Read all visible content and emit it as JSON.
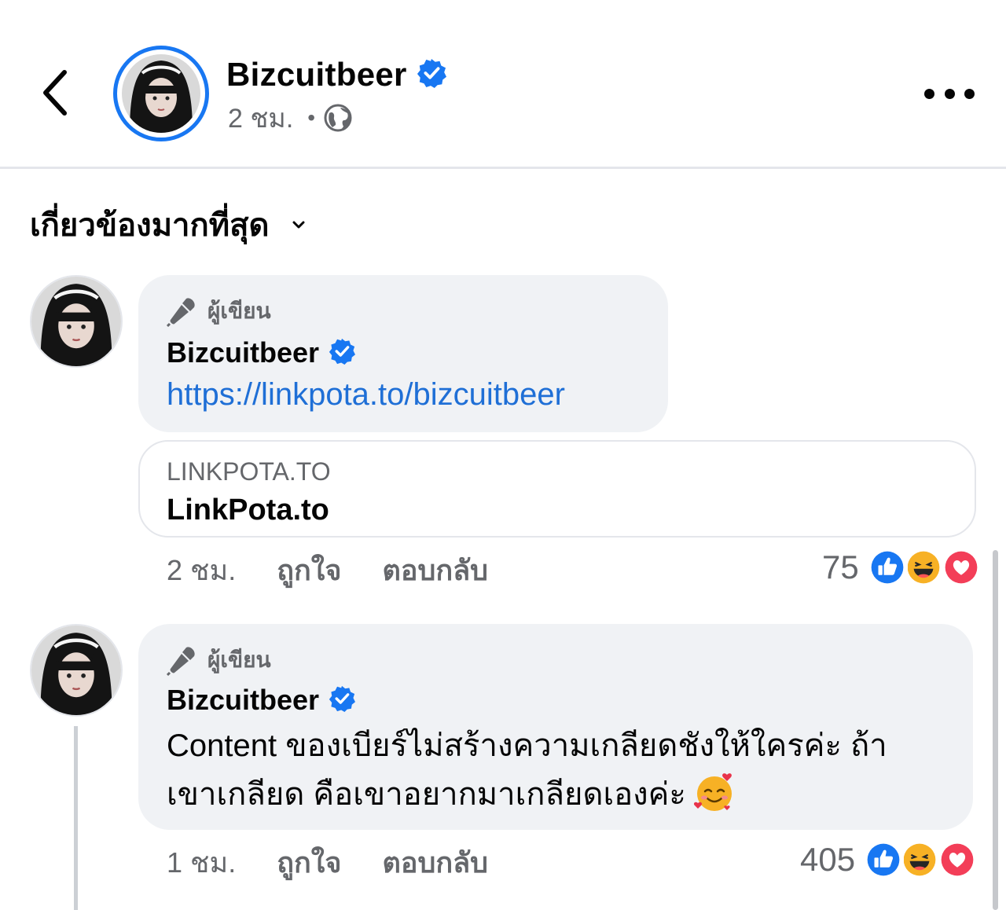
{
  "header": {
    "name": "Bizcuitbeer",
    "time": "2 ชม.",
    "privacy_icon": "globe-icon",
    "back_icon": "chevron-left-icon",
    "more_icon": "more-horizontal-icon"
  },
  "sort": {
    "label": "เกี่ยวข้องมากที่สุด",
    "icon": "chevron-down-icon"
  },
  "comments": [
    {
      "badge": "ผู้เขียน",
      "author": "Bizcuitbeer",
      "link": "https://linkpota.to/bizcuitbeer",
      "link_preview": {
        "domain": "LINKPOTA.TO",
        "title": "LinkPota.to"
      },
      "time": "2 ชม.",
      "like_label": "ถูกใจ",
      "reply_label": "ตอบกลับ",
      "reaction_count": "75",
      "reactions": [
        "like",
        "haha",
        "love"
      ]
    },
    {
      "badge": "ผู้เขียน",
      "author": "Bizcuitbeer",
      "text_line1": "Content ของเบียร์ไม่สร้างความเกลียดชังให้ใครค่ะ ถ้า",
      "text_line2": "เขาเกลียด คือเขาอยากมาเกลียดเองค่ะ",
      "text_emoji": "smiling-face-with-hearts-emoji",
      "time": "1 ชม.",
      "like_label": "ถูกใจ",
      "reply_label": "ตอบกลับ",
      "reaction_count": "405",
      "reactions": [
        "like",
        "haha",
        "love"
      ]
    }
  ],
  "colors": {
    "accent": "#1877f2",
    "link": "#1f6fd6",
    "bubble": "#f0f2f5",
    "secondary_text": "#65676b",
    "love": "#f33e58",
    "haha": "#f7b125"
  }
}
